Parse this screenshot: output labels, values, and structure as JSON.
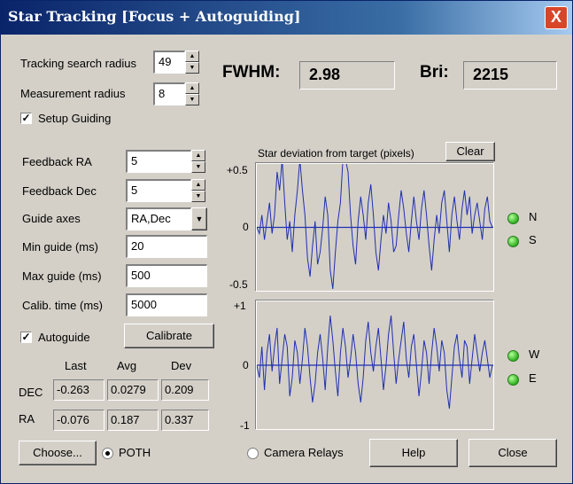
{
  "window": {
    "title": "Star Tracking [Focus + Autoguiding]",
    "close_glyph": "X"
  },
  "tracking": {
    "search_radius_label": "Tracking search radius",
    "search_radius": "49",
    "measurement_radius_label": "Measurement radius",
    "measurement_radius": "8",
    "setup_guiding_label": "Setup Guiding",
    "setup_guiding_checked": true
  },
  "readouts": {
    "fwhm_label": "FWHM:",
    "fwhm": "2.98",
    "bri_label": "Bri:",
    "bri": "2215"
  },
  "guiding": {
    "feedback_ra_label": "Feedback RA",
    "feedback_ra": "5",
    "feedback_dec_label": "Feedback Dec",
    "feedback_dec": "5",
    "guide_axes_label": "Guide axes",
    "guide_axes": "RA,Dec",
    "min_guide_label": "Min guide (ms)",
    "min_guide": "20",
    "max_guide_label": "Max guide (ms)",
    "max_guide": "500",
    "calib_time_label": "Calib. time (ms)",
    "calib_time": "5000",
    "autoguide_label": "Autoguide",
    "autoguide_checked": true,
    "calibrate_label": "Calibrate"
  },
  "stats": {
    "headers": [
      "Last",
      "Avg",
      "Dev"
    ],
    "rows": [
      {
        "label": "DEC",
        "values": [
          "-0.263",
          "0.0279",
          "0.209"
        ]
      },
      {
        "label": "RA",
        "values": [
          "-0.076",
          "0.187",
          "0.337"
        ]
      }
    ]
  },
  "deviation": {
    "title": "Star deviation from target (pixels)",
    "clear_label": "Clear",
    "top": {
      "max_label": "+0.5",
      "zero_label": "0",
      "min_label": "-0.5",
      "led1": "N",
      "led2": "S"
    },
    "bottom": {
      "max_label": "+1",
      "zero_label": "0",
      "min_label": "-1",
      "led1": "W",
      "led2": "E"
    }
  },
  "footer": {
    "choose_label": "Choose...",
    "poth_label": "POTH",
    "poth_selected": true,
    "camera_relays_label": "Camera Relays",
    "camera_relays_selected": false,
    "help_label": "Help",
    "close_label": "Close"
  },
  "colors": {
    "trace": "#1f2fb0",
    "led": "#2fb020",
    "titlebar": "#0a246a"
  },
  "chart_data": [
    {
      "type": "line",
      "series": [
        {
          "values": [
            0,
            -0.05,
            0.1,
            -0.1,
            0.05,
            0.2,
            -0.05,
            0.1,
            0.45,
            0.3,
            0.55,
            0.2,
            -0.1,
            0.05,
            -0.2,
            0.1,
            0.3,
            0.55,
            0.3,
            0.1,
            -0.25,
            -0.4,
            -0.15,
            0.05,
            -0.3,
            -0.2,
            0.0,
            0.25,
            0.1,
            -0.35,
            -0.5,
            -0.2,
            0.05,
            0.2,
            0.55,
            0.55,
            0.45,
            0.1,
            -0.15,
            -0.3,
            0.05,
            0.25,
            0.1,
            -0.1,
            0.2,
            0.35,
            0.1,
            -0.2,
            -0.35,
            -0.1,
            0.1,
            -0.05,
            0.2,
            0.05,
            -0.2,
            -0.15,
            0.1,
            0.3,
            0.15,
            -0.05,
            -0.2,
            0.05,
            0.25,
            0.05,
            -0.1,
            0.15,
            0.3,
            0.1,
            -0.15,
            -0.35,
            -0.1,
            0.1,
            -0.05,
            0.2,
            0.3,
            0.05,
            -0.2,
            0.1,
            0.25,
            0.05,
            -0.1,
            0.15,
            0.3,
            0.1,
            0.25,
            -0.05,
            0.1,
            0.2,
            0.05,
            -0.1,
            0.15,
            0.25,
            0.05,
            0.0
          ]
        }
      ],
      "ylim": [
        -0.5,
        0.5
      ]
    },
    {
      "type": "line",
      "series": [
        {
          "values": [
            0,
            -0.2,
            0.3,
            -0.4,
            0.2,
            0.5,
            -0.1,
            0.3,
            0.6,
            -0.3,
            0.1,
            0.5,
            0.3,
            -0.5,
            -0.2,
            0.4,
            0.2,
            -0.3,
            0.1,
            0.6,
            0.3,
            -0.2,
            -0.6,
            -0.3,
            0.2,
            0.5,
            0.1,
            -0.4,
            0.3,
            0.8,
            0.4,
            -0.1,
            -0.5,
            0.2,
            0.6,
            0.3,
            -0.2,
            0.1,
            0.5,
            0.2,
            -0.3,
            -0.6,
            -0.2,
            0.4,
            0.7,
            0.2,
            -0.1,
            0.3,
            0.6,
            0.1,
            -0.4,
            0.0,
            0.5,
            0.8,
            0.2,
            -0.3,
            0.1,
            0.4,
            0.7,
            0.1,
            -0.2,
            0.3,
            0.5,
            0.0,
            -0.5,
            -0.1,
            0.4,
            0.2,
            -0.3,
            0.2,
            0.6,
            0.3,
            -0.1,
            0.4,
            0.2,
            -0.4,
            -0.7,
            -0.2,
            0.3,
            0.5,
            0.1,
            -0.2,
            0.4,
            0.3,
            -0.3,
            0.1,
            0.5,
            0.2,
            -0.1,
            0.2,
            0.4,
            0.1,
            -0.2,
            0.0
          ]
        }
      ],
      "ylim": [
        -1,
        1
      ]
    }
  ]
}
